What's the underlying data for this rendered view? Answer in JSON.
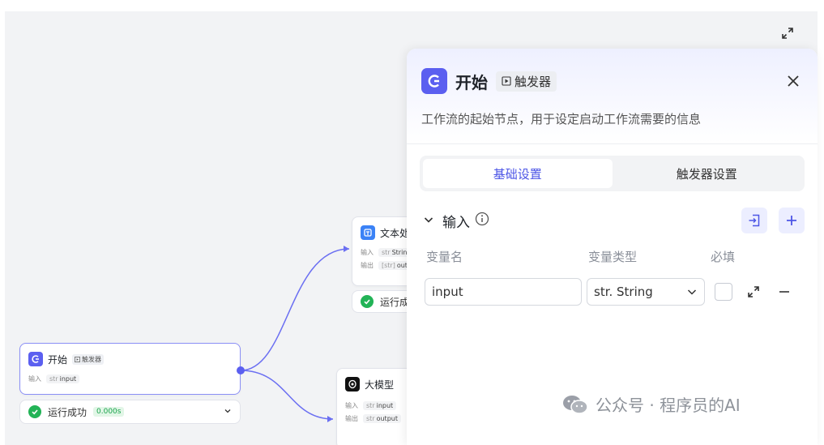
{
  "canvas": {
    "start_node": {
      "title": "开始",
      "tag": "触发器",
      "input_label": "输入",
      "input_chip_prefix": "str",
      "input_chip_value": "input",
      "status_text": "运行成功",
      "status_time": "0.000s"
    },
    "text_node": {
      "title": "文本处",
      "row1_label": "输入",
      "row1_chip_prefix": "str",
      "row1_chip_value": "Strin",
      "row2_label": "输出",
      "row2_chip_prefix": "[str]",
      "row2_chip_value": "outp",
      "status_text": "运行成"
    },
    "llm_node": {
      "title": "大模型",
      "row1_label": "输入",
      "row1_chip_prefix": "str",
      "row1_chip_value": "input",
      "row2_label": "输出",
      "row2_chip_prefix": "str",
      "row2_chip_value": "output"
    },
    "accent_color": "#5b5ff0"
  },
  "panel": {
    "title": "开始",
    "tag": "触发器",
    "description": "工作流的起始节点，用于设定启动工作流需要的信息",
    "tabs": [
      {
        "label": "基础设置",
        "active": true
      },
      {
        "label": "触发器设置",
        "active": false
      }
    ],
    "section": {
      "title": "输入",
      "columns": [
        "变量名",
        "变量类型",
        "必填"
      ],
      "rows": [
        {
          "name": "input",
          "type": "str. String",
          "required": false
        }
      ]
    }
  },
  "watermark": {
    "text": "公众号 · 程序员的AI"
  }
}
